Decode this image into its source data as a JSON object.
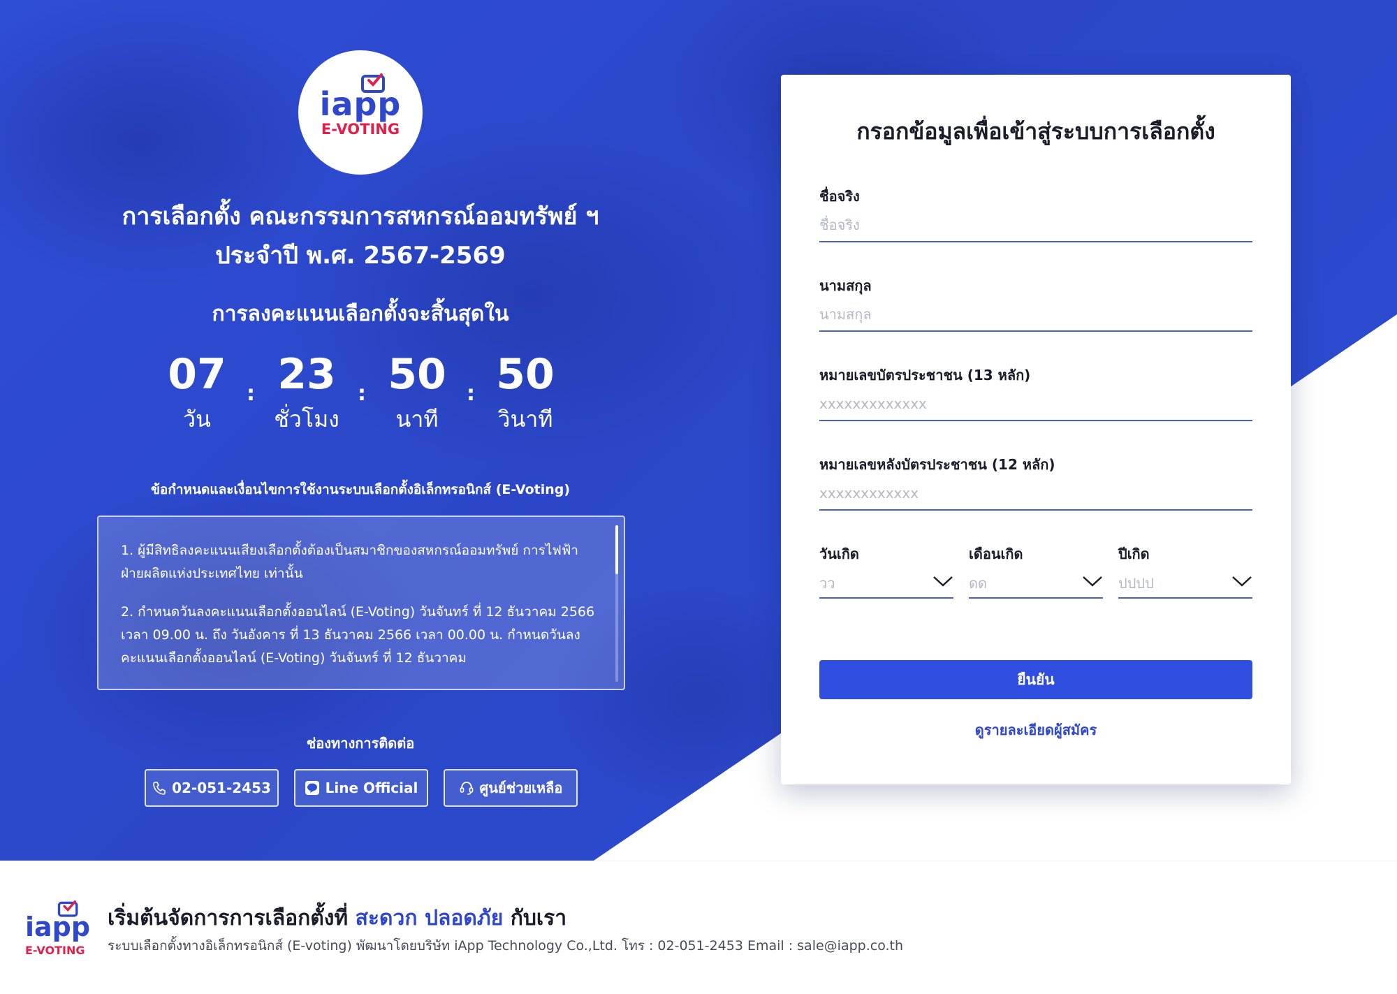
{
  "brand": {
    "logo_word": "iapp",
    "logo_sub": "E-VOTING"
  },
  "election": {
    "title_line1": "การเลือกตั้ง คณะกรรมการสหกรณ์ออมทรัพย์ ฯ",
    "title_line2": "ประจำปี พ.ศ. 2567-2569",
    "countdown_heading": "การลงคะแนนเลือกตั้งจะสิ้นสุดใน",
    "countdown": {
      "days": "07",
      "days_label": "วัน",
      "hours": "23",
      "hours_label": "ชั่วโมง",
      "minutes": "50",
      "minutes_label": "นาที",
      "seconds": "50",
      "seconds_label": "วินาที",
      "separator": ":"
    }
  },
  "terms": {
    "heading": "ข้อกำหนดและเงื่อนไขการใช้งานระบบเลือกตั้งอิเล็กทรอนิกส์ (E-Voting)",
    "item1": "1. ผู้มีสิทธิลงคะแนนเสียงเลือกตั้งต้องเป็นสมาชิกของสหกรณ์ออมทรัพย์ การไฟฟ้าฝ่ายผลิตแห่งประเทศไทย เท่านั้น",
    "item2": "2. กำหนดวันลงคะแนนเลือกตั้งออนไลน์ (E-Voting) วันจันทร์ ที่ 12 ธันวาคม 2566 เวลา 09.00 น. ถึง วันอังคาร ที่ 13 ธันวาคม 2566 เวลา 00.00 น. กำหนดวันลงคะแนนเลือกตั้งออนไลน์ (E-Voting) วันจันทร์ ที่ 12 ธันวาคม"
  },
  "contact": {
    "heading": "ช่องทางการติดต่อ",
    "phone": "02-051-2453",
    "line": "Line Official",
    "help": "ศูนย์ช่วยเหลือ"
  },
  "form": {
    "title": "กรอกข้อมูลเพื่อเข้าสู่ระบบการเลือกตั้ง",
    "first_name_label": "ชื่อจริง",
    "first_name_placeholder": "ชื่อจริง",
    "last_name_label": "นามสกุล",
    "last_name_placeholder": "นามสกุล",
    "id_label": "หมายเลขบัตรประชาชน (13 หลัก)",
    "id_placeholder": "xxxxxxxxxxxxx",
    "back_id_label": "หมายเลขหลังบัตรประชาชน (12 หลัก)",
    "back_id_placeholder": "xxxxxxxxxxxx",
    "birth_day_label": "วันเกิด",
    "birth_day_value": "วว",
    "birth_month_label": "เดือนเกิด",
    "birth_month_value": "ดด",
    "birth_year_label": "ปีเกิด",
    "birth_year_value": "ปปปป",
    "submit": "ยืนยัน",
    "details_link": "ดูรายละเอียดผู้สมัคร"
  },
  "footer": {
    "headline_pre": "เริ่มต้นจัดการการเลือกตั้งที่",
    "headline_highlight": "สะดวก ปลอดภัย",
    "headline_post": "กับเรา",
    "sub": "ระบบเลือกตั้งทางอิเล็กทรอนิกส์ (E-voting) พัฒนาโดยบริษัท iApp Technology Co.,Ltd. โทร : 02-051-2453 Email : sale@iapp.co.th"
  },
  "colors": {
    "primary": "#2f4ee0",
    "brand_blue": "#2f47cc",
    "brand_red": "#e0204a"
  },
  "icons": {
    "phone": "phone-icon",
    "line": "line-icon",
    "help": "headset-icon",
    "select": "chevron-down-icon"
  }
}
